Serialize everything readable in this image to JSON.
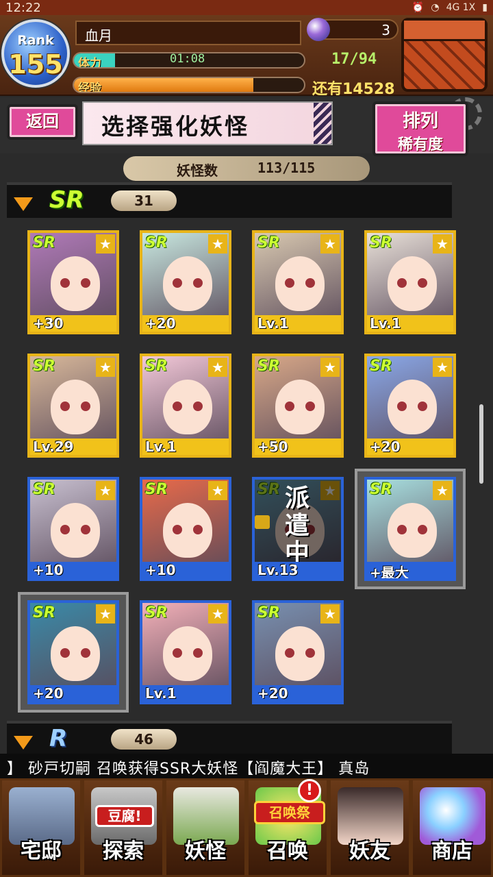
{
  "status": {
    "time": "12:22",
    "network": "4G 1X"
  },
  "player": {
    "rank_label": "Rank",
    "rank": "155",
    "name": "血月",
    "gems": "3"
  },
  "stamina": {
    "label": "体力",
    "timer": "01:08",
    "value": "17/94",
    "fill": 0.18
  },
  "exp": {
    "label": "经验",
    "remaining": "还有14528",
    "fill": 0.78
  },
  "top": {
    "back_label": "返回",
    "title": "选择强化妖怪",
    "sort_label": "排列",
    "sort_value": "稀有度"
  },
  "inventory": {
    "label": "妖怪数",
    "value": "113/115"
  },
  "groups": [
    {
      "rarity": "SR",
      "count": "31"
    },
    {
      "rarity": "R",
      "count": "46"
    }
  ],
  "cards": [
    {
      "rarity": "SR",
      "level": "+30",
      "frame": "gold"
    },
    {
      "rarity": "SR",
      "level": "+20",
      "frame": "gold"
    },
    {
      "rarity": "SR",
      "level": "Lv.1",
      "frame": "gold"
    },
    {
      "rarity": "SR",
      "level": "Lv.1",
      "frame": "gold"
    },
    {
      "rarity": "SR",
      "level": "Lv.29",
      "frame": "gold"
    },
    {
      "rarity": "SR",
      "level": "Lv.1",
      "frame": "gold"
    },
    {
      "rarity": "SR",
      "level": "+50",
      "frame": "gold"
    },
    {
      "rarity": "SR",
      "level": "+20",
      "frame": "gold"
    },
    {
      "rarity": "SR",
      "level": "+10",
      "frame": "blue"
    },
    {
      "rarity": "SR",
      "level": "+10",
      "frame": "blue"
    },
    {
      "rarity": "SR",
      "level": "Lv.13",
      "frame": "blue",
      "status": "派遣中"
    },
    {
      "rarity": "SR",
      "level": "+最大",
      "frame": "blue"
    },
    {
      "rarity": "SR",
      "level": "+20",
      "frame": "blue"
    },
    {
      "rarity": "SR",
      "level": "Lv.1",
      "frame": "blue"
    },
    {
      "rarity": "SR",
      "level": "+20",
      "frame": "blue"
    }
  ],
  "ticker": "】  砂戸切嗣 召唤获得SSR大妖怪【阎魔大王】   真岛",
  "nav": [
    {
      "label": "宅邸"
    },
    {
      "label": "探索",
      "badge": "豆腐!"
    },
    {
      "label": "妖怪"
    },
    {
      "label": "召唤",
      "badge": "召唤祭",
      "alert": "!"
    },
    {
      "label": "妖友"
    },
    {
      "label": "商店"
    }
  ],
  "colors": {
    "gold_frame": "#e8b418",
    "blue_frame": "#2a62d8",
    "accent_pink": "#e04a9a",
    "sr_green": "#ccff33"
  }
}
